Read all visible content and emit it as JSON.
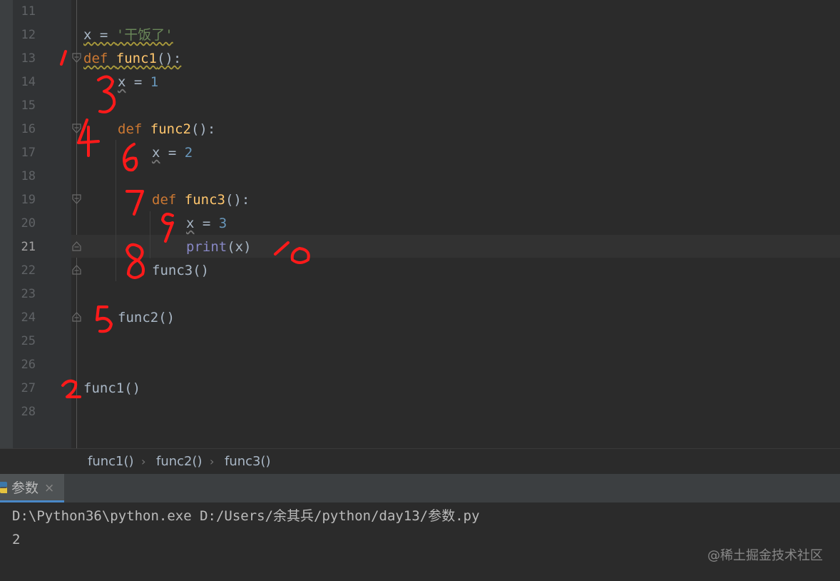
{
  "editor": {
    "current_line": "21",
    "lines": [
      {
        "n": "11",
        "indent": 0,
        "tokens": []
      },
      {
        "n": "12",
        "indent": 0,
        "tokens": [
          {
            "t": "x = ",
            "c": "plain"
          },
          {
            "t": "'干饭了'",
            "c": "str"
          }
        ]
      },
      {
        "n": "13",
        "indent": 0,
        "tokens": [
          {
            "t": "def ",
            "c": "kw"
          },
          {
            "t": "func1",
            "c": "fn"
          },
          {
            "t": "():",
            "c": "plain"
          }
        ]
      },
      {
        "n": "14",
        "indent": 1,
        "tokens": [
          {
            "t": "x",
            "c": "plain"
          },
          {
            "t": " = ",
            "c": "plain"
          },
          {
            "t": "1",
            "c": "num"
          }
        ]
      },
      {
        "n": "15",
        "indent": 0,
        "tokens": []
      },
      {
        "n": "16",
        "indent": 1,
        "tokens": [
          {
            "t": "def ",
            "c": "kw"
          },
          {
            "t": "func2",
            "c": "fn"
          },
          {
            "t": "():",
            "c": "plain"
          }
        ]
      },
      {
        "n": "17",
        "indent": 2,
        "tokens": [
          {
            "t": "x",
            "c": "plain"
          },
          {
            "t": " = ",
            "c": "plain"
          },
          {
            "t": "2",
            "c": "num"
          }
        ]
      },
      {
        "n": "18",
        "indent": 0,
        "tokens": []
      },
      {
        "n": "19",
        "indent": 2,
        "tokens": [
          {
            "t": "def ",
            "c": "kw"
          },
          {
            "t": "func3",
            "c": "fn"
          },
          {
            "t": "():",
            "c": "plain"
          }
        ]
      },
      {
        "n": "20",
        "indent": 3,
        "tokens": [
          {
            "t": "x",
            "c": "plain"
          },
          {
            "t": " = ",
            "c": "plain"
          },
          {
            "t": "3",
            "c": "num"
          }
        ]
      },
      {
        "n": "21",
        "indent": 3,
        "tokens": [
          {
            "t": "print",
            "c": "bi"
          },
          {
            "t": "(x)",
            "c": "plain"
          }
        ]
      },
      {
        "n": "22",
        "indent": 2,
        "tokens": [
          {
            "t": "func3()",
            "c": "plain"
          }
        ]
      },
      {
        "n": "23",
        "indent": 0,
        "tokens": []
      },
      {
        "n": "24",
        "indent": 1,
        "tokens": [
          {
            "t": "func2()",
            "c": "plain"
          }
        ]
      },
      {
        "n": "25",
        "indent": 0,
        "tokens": []
      },
      {
        "n": "26",
        "indent": 0,
        "tokens": []
      },
      {
        "n": "27",
        "indent": 0,
        "tokens": [
          {
            "t": "func1()",
            "c": "plain"
          }
        ]
      },
      {
        "n": "28",
        "indent": 0,
        "tokens": []
      }
    ]
  },
  "breadcrumb": [
    "func1()",
    "func2()",
    "func3()"
  ],
  "run_panel": {
    "tab_label": "参数",
    "tab_close": "×",
    "console_lines": [
      "D:\\Python36\\python.exe D:/Users/余其兵/python/day13/参数.py",
      "2"
    ]
  },
  "annotations": [
    "1",
    "2",
    "3",
    "4",
    "5",
    "6",
    "7",
    "8",
    "9",
    "10"
  ],
  "watermark": "@稀土掘金技术社区",
  "colors": {
    "keyword": "#cc7832",
    "function": "#ffc66d",
    "number": "#6897bb",
    "string": "#6a8759",
    "builtin": "#8888c6",
    "plain": "#a9b7c6",
    "annotation": "#ff1a1a"
  }
}
